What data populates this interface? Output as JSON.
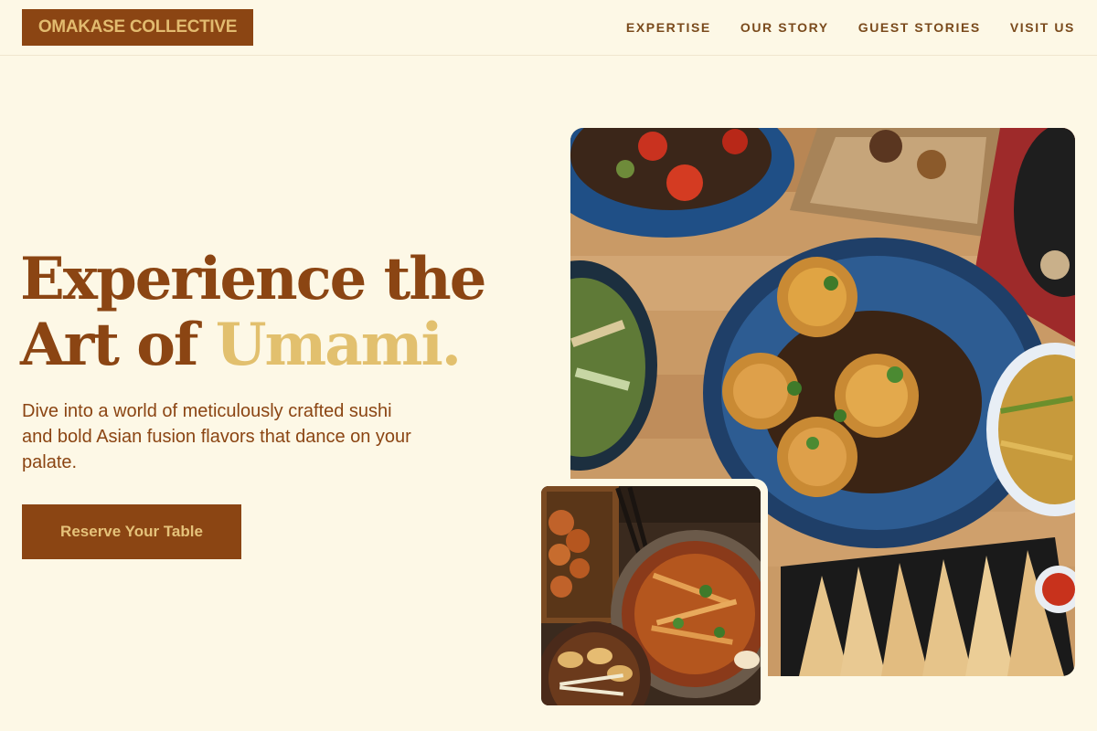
{
  "brand": {
    "name": "OMAKASE COLLECTIVE"
  },
  "nav": {
    "items": [
      {
        "label": "EXPERTISE"
      },
      {
        "label": "OUR STORY"
      },
      {
        "label": "GUEST STORIES"
      },
      {
        "label": "VISIT US"
      }
    ]
  },
  "hero": {
    "title_line1": "Experience the",
    "title_line2_prefix": "Art of ",
    "title_accent": "Umami.",
    "subtitle": "Dive into a world of meticulously crafted sushi and bold Asian fusion flavors that dance on your palate.",
    "cta_label": "Reserve Your Table"
  },
  "images": {
    "main": {
      "icon": "food-spread-photo"
    },
    "secondary": {
      "icon": "ramen-and-gyoza-photo"
    }
  },
  "colors": {
    "background": "#fdf8e6",
    "primary": "#8b4513",
    "accent": "#e2c06e"
  }
}
